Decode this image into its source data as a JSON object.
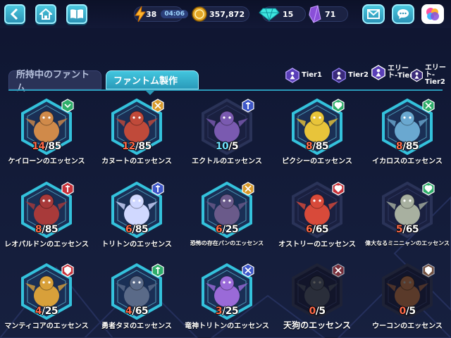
{
  "topbar": {
    "energy": "38",
    "timer": "04:06",
    "gold": "357,872",
    "gems": "15",
    "crystals": "71"
  },
  "tabs": {
    "owned": "所持中のファントム",
    "craft": "ファントム製作"
  },
  "legend": [
    {
      "label": "Tier1",
      "color": "#8f7df0"
    },
    {
      "label": "Tier2",
      "color": "#8f7df0"
    },
    {
      "label": "エリート-Tier1",
      "line1": "エリー",
      "line2": "ト-Tier1",
      "color": "#8f7df0"
    },
    {
      "label": "エリート-Tier2",
      "line1": "エリー",
      "line2": "ト-Tier2",
      "color": "#8f7df0"
    }
  ],
  "essences": [
    {
      "name": "ケイローンのエッセンス",
      "have": "14",
      "need": "85",
      "frame": "teal",
      "badge": "#2fae6a",
      "badge_icon": "chevron-down-icon",
      "creature": "#d08a4a"
    },
    {
      "name": "カヌートのエッセンス",
      "have": "12",
      "need": "85",
      "frame": "teal",
      "badge": "#d89a2a",
      "badge_icon": "cross-swords-icon",
      "creature": "#c04a3a"
    },
    {
      "name": "エクトルのエッセンス",
      "have": "10",
      "need": "5",
      "frame": "dark",
      "badge": "#3e57c8",
      "badge_icon": "staff-icon",
      "creature": "#7a5ab0"
    },
    {
      "name": "ピクシーのエッセンス",
      "have": "8",
      "need": "85",
      "frame": "teal",
      "badge": "#2fae6a",
      "badge_icon": "heart-icon",
      "creature": "#e8c43a"
    },
    {
      "name": "イカロスのエッセンス",
      "have": "8",
      "need": "85",
      "frame": "teal",
      "badge": "#2fae6a",
      "badge_icon": "cross-swords-icon",
      "creature": "#6aa8d0"
    },
    {
      "name": "レオパルドンのエッセンス",
      "have": "8",
      "need": "85",
      "frame": "teal",
      "badge": "#c8323a",
      "badge_icon": "staff-icon",
      "creature": "#a83a3a"
    },
    {
      "name": "トリトンのエッセンス",
      "have": "6",
      "need": "85",
      "frame": "teal",
      "badge": "#3e57c8",
      "badge_icon": "staff-icon",
      "creature": "#d0d8ff"
    },
    {
      "name": "恐怖の存在パンのエッセンス",
      "have": "6",
      "need": "25",
      "frame": "teal",
      "badge": "#d89a2a",
      "badge_icon": "cross-swords-icon",
      "creature": "#6a5a8a",
      "small": true
    },
    {
      "name": "オストリーのエッセンス",
      "have": "6",
      "need": "65",
      "frame": "dark",
      "badge": "#c8323a",
      "badge_icon": "heart-icon",
      "creature": "#d84a3a"
    },
    {
      "name": "偉大なるミニニャンのエッセンス",
      "have": "5",
      "need": "65",
      "frame": "dark",
      "badge": "#2fae6a",
      "badge_icon": "heart-icon",
      "creature": "#a8b0a0",
      "small": true
    },
    {
      "name": "マンティコアのエッセンス",
      "have": "4",
      "need": "25",
      "frame": "teal",
      "badge": "#c8323a",
      "badge_icon": "shield-icon",
      "creature": "#d8a03a"
    },
    {
      "name": "勇者タヌのエッセンス",
      "have": "4",
      "need": "65",
      "frame": "teal",
      "badge": "#2fae6a",
      "badge_icon": "staff-icon",
      "creature": "#5a6a88"
    },
    {
      "name": "竜神トリトンのエッセンス",
      "have": "3",
      "need": "25",
      "frame": "teal",
      "badge": "#3e57c8",
      "badge_icon": "cross-swords-icon",
      "creature": "#9a6ad8"
    },
    {
      "name": "天狗のエッセンス",
      "have": "0",
      "need": "5",
      "frame": "locked",
      "badge": "#b83a3a",
      "badge_icon": "cross-swords-icon",
      "creature": "#2a2e3a",
      "big": true
    },
    {
      "name": "ウーコンのエッセンス",
      "have": "0",
      "need": "5",
      "frame": "locked",
      "badge": "#b07040",
      "badge_icon": "shield-icon",
      "creature": "#5a3a2a"
    }
  ]
}
